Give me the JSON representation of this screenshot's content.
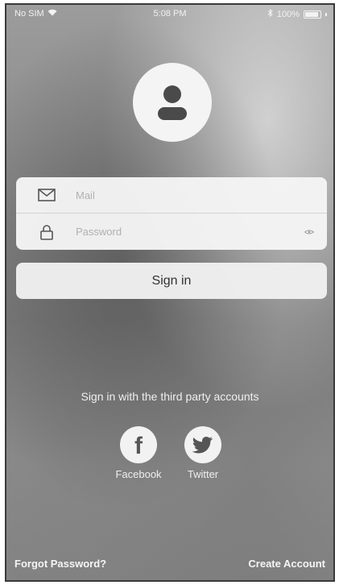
{
  "status_bar": {
    "carrier": "No SIM",
    "time": "5:08 PM",
    "battery": "100%",
    "icons": [
      "wifi-icon",
      "bluetooth-icon",
      "battery-icon"
    ]
  },
  "avatar": {
    "icon": "user-avatar-icon"
  },
  "login": {
    "email_placeholder": "Mail",
    "email_icon": "mail-icon",
    "password_placeholder": "Password",
    "password_icon": "lock-icon",
    "password_toggle_icon": "eye-icon"
  },
  "sign_in_label": "Sign in",
  "third_party": {
    "heading": "Sign in with the third party accounts",
    "facebook_label": "Facebook",
    "twitter_label": "Twitter"
  },
  "footer": {
    "forgot_password": "Forgot Password?",
    "create_account": "Create Account"
  },
  "colors": {
    "card_background": "#f5f5f5",
    "text_on_background": "#efefef",
    "icon_gray": "#555555"
  }
}
